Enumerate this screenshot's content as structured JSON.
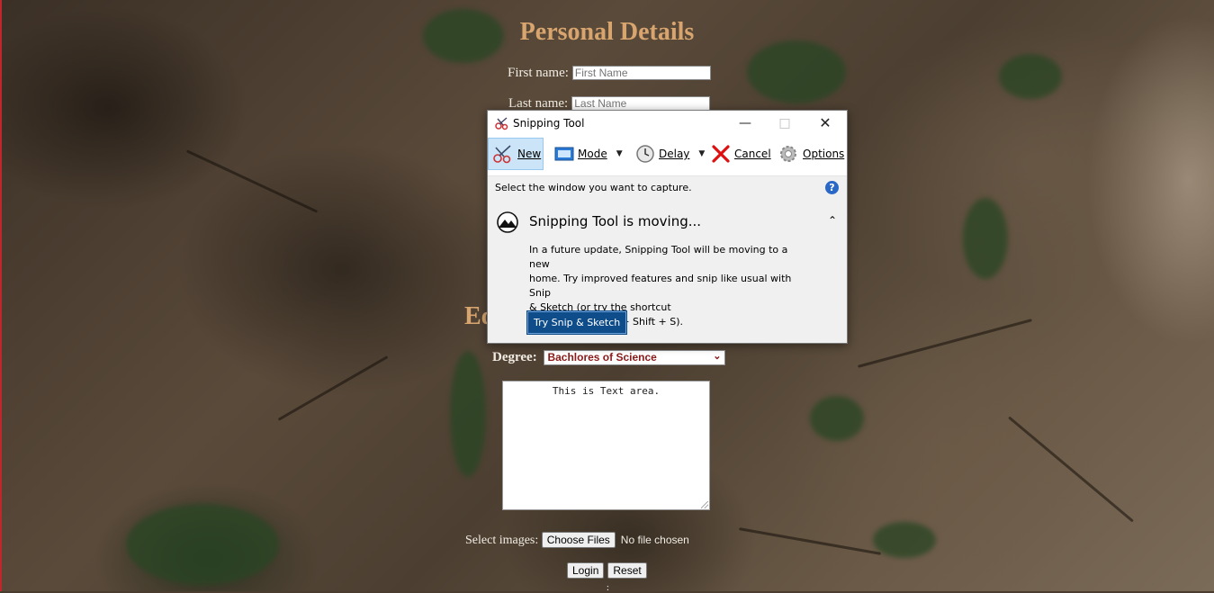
{
  "form": {
    "heading": "Personal Details",
    "first_name_label": "First name:",
    "first_name_placeholder": "First Name",
    "last_name_label": "Last name:",
    "last_name_placeholder": "Last Name",
    "education_heading_partial": "Ed",
    "degree_label": "Degree:",
    "degree_selected": "Bachlores of Science",
    "textarea_value": "This is Text area.",
    "select_images_label": "Select images:",
    "choose_files_label": "Choose Files",
    "no_file_text": "No file chosen",
    "login_label": "Login",
    "reset_label": "Reset"
  },
  "snipping_tool": {
    "title": "Snipping Tool",
    "toolbar": {
      "new_label": "New",
      "mode_label": "Mode",
      "delay_label": "Delay",
      "cancel_label": "Cancel",
      "options_label": "Options"
    },
    "hint": "Select the window you want to capture.",
    "help_icon": "?",
    "notice_title": "Snipping Tool is moving...",
    "notice_body": [
      "In a future update, Snipping Tool will be moving to a new",
      "home. Try improved features and snip like usual with Snip",
      "& Sketch (or try the shortcut",
      "Windows logo key + Shift + S)."
    ],
    "try_button": "Try Snip & Sketch"
  },
  "colors": {
    "heading": "#d8a56f",
    "label": "#f2ede4",
    "accent_button": "#0e4c8a",
    "select_text": "#8b1a1a"
  },
  "icons": [
    "scissors-icon",
    "mode-icon",
    "clock-icon",
    "cancel-x-icon",
    "gear-icon",
    "help-icon",
    "mountain-icon",
    "chevron-up-icon",
    "minimize-icon",
    "maximize-icon",
    "close-icon"
  ]
}
